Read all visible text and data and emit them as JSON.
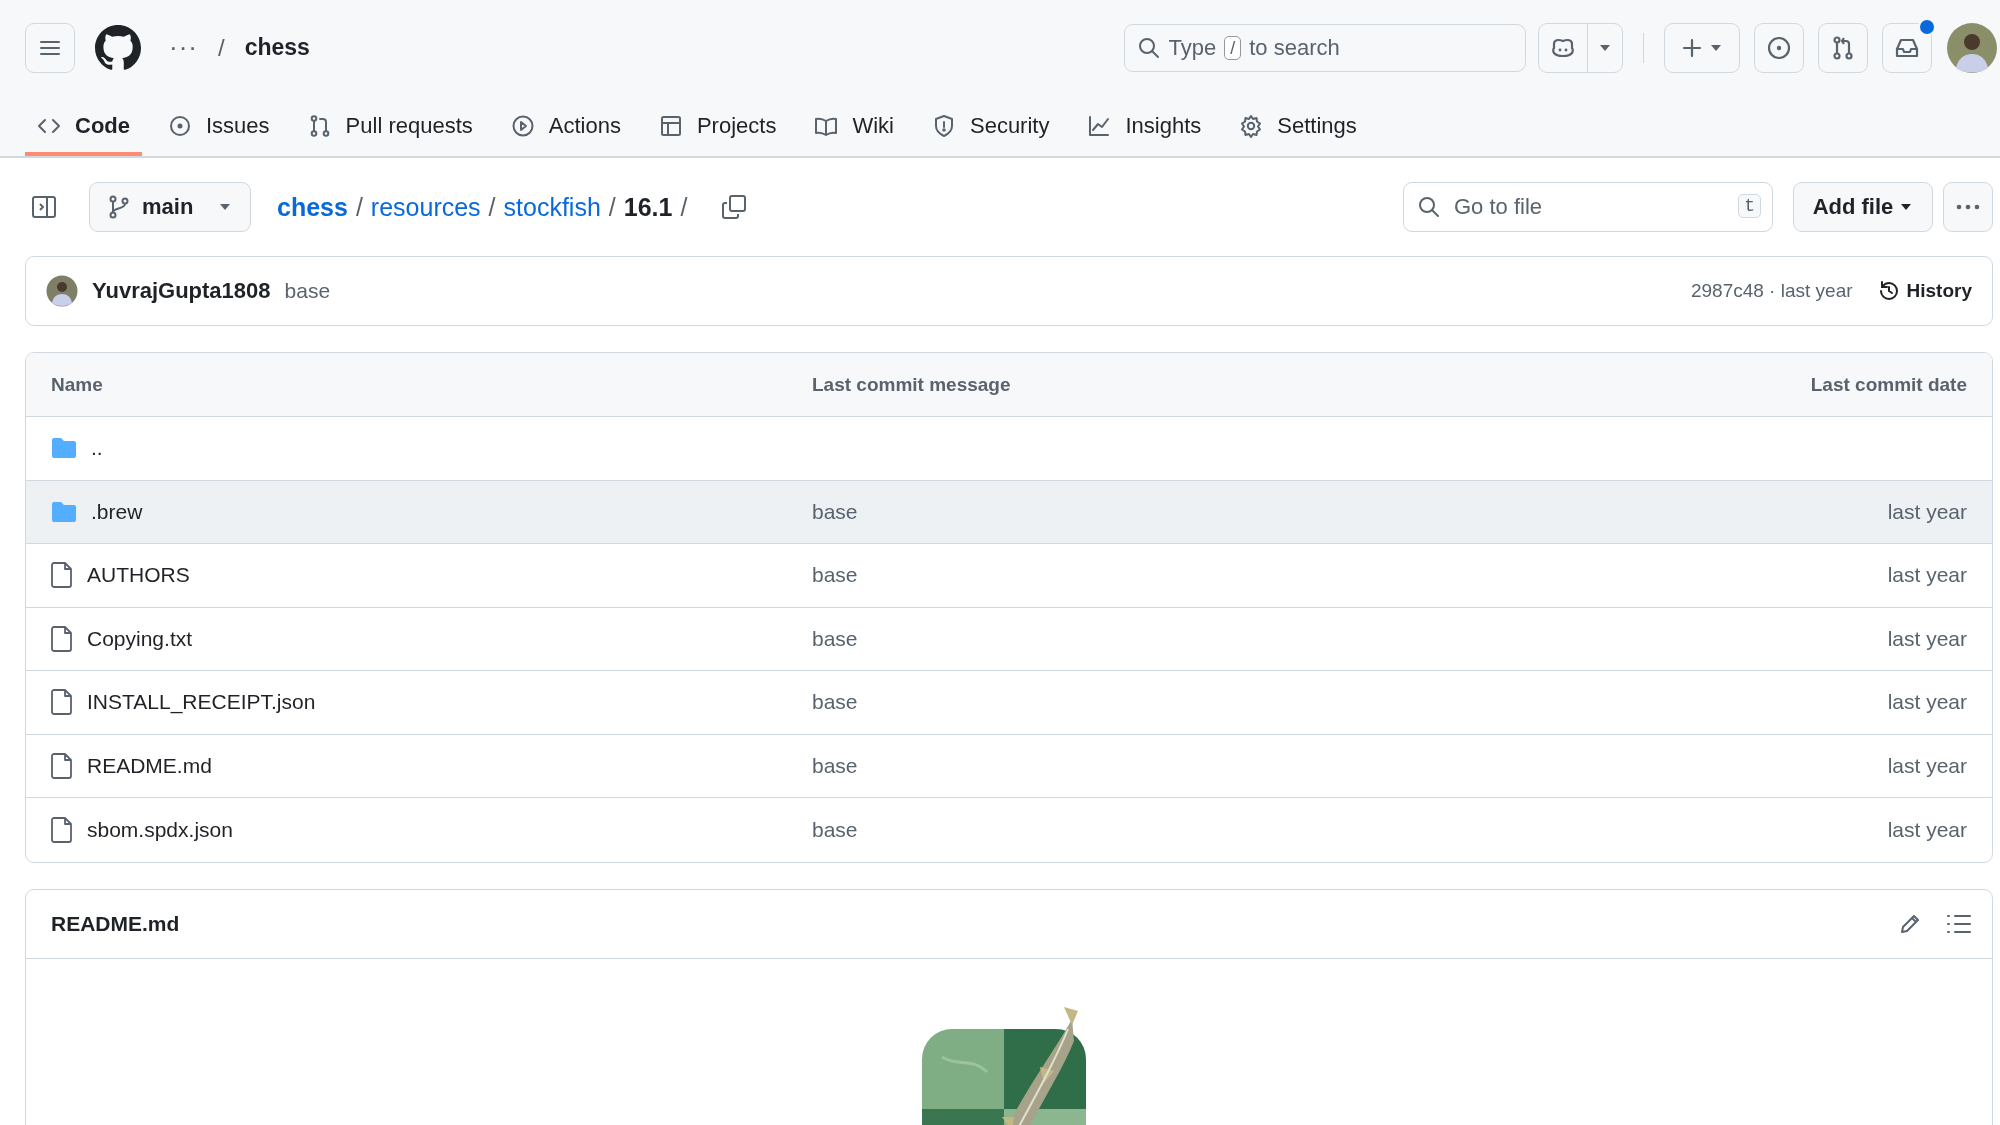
{
  "header": {
    "ellipsis": "···",
    "separator": "/",
    "repo": "chess",
    "search": {
      "before": "Type",
      "key": "/",
      "after": "to search"
    },
    "inbox_unread": true
  },
  "tabs": [
    {
      "label": "Code",
      "selected": true
    },
    {
      "label": "Issues",
      "selected": false
    },
    {
      "label": "Pull requests",
      "selected": false
    },
    {
      "label": "Actions",
      "selected": false
    },
    {
      "label": "Projects",
      "selected": false
    },
    {
      "label": "Wiki",
      "selected": false
    },
    {
      "label": "Security",
      "selected": false
    },
    {
      "label": "Insights",
      "selected": false
    },
    {
      "label": "Settings",
      "selected": false
    }
  ],
  "branch": "main",
  "breadcrumb": {
    "links": [
      "chess",
      "resources",
      "stockfish"
    ],
    "current": "16.1",
    "separator": "/"
  },
  "go_to_file": {
    "placeholder": "Go to file",
    "key": "t"
  },
  "add_file": "Add file",
  "commit": {
    "author": "YuvrajGupta1808",
    "message": "base",
    "sha_time": "2987c48 · last year",
    "history": "History"
  },
  "table": {
    "columns": [
      "Name",
      "Last commit message",
      "Last commit date"
    ],
    "rows": [
      {
        "kind": "folder",
        "name": "..",
        "highlighted": false
      },
      {
        "kind": "folder",
        "name": ".brew",
        "message": "base",
        "date": "last year",
        "highlighted": true
      },
      {
        "kind": "file",
        "name": "AUTHORS",
        "message": "base",
        "date": "last year",
        "highlighted": false
      },
      {
        "kind": "file",
        "name": "Copying.txt",
        "message": "base",
        "date": "last year",
        "highlighted": false
      },
      {
        "kind": "file",
        "name": "INSTALL_RECEIPT.json",
        "message": "base",
        "date": "last year",
        "highlighted": false
      },
      {
        "kind": "file",
        "name": "README.md",
        "message": "base",
        "date": "last year",
        "highlighted": false
      },
      {
        "kind": "file",
        "name": "sbom.spdx.json",
        "message": "base",
        "date": "last year",
        "highlighted": false
      }
    ]
  },
  "readme": {
    "title": "README.md"
  }
}
